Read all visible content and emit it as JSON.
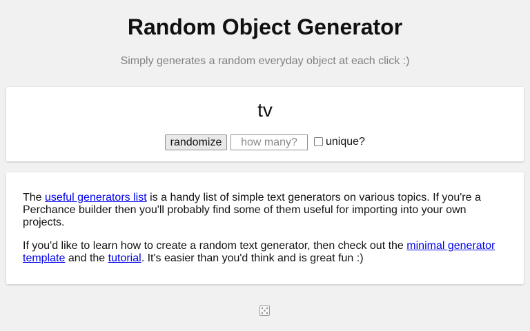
{
  "header": {
    "title": "Random Object Generator",
    "subtitle": "Simply generates a random everyday object at each click :)"
  },
  "generator": {
    "output": "tv",
    "randomize_label": "randomize",
    "count_placeholder": "how many?",
    "count_value": "",
    "unique_label": "unique?",
    "unique_checked": false
  },
  "info": {
    "p1": {
      "pre": "The ",
      "link": "useful generators list",
      "post": " is a handy list of simple text generators on various topics. If you're a Perchance builder then you'll probably find some of them useful for importing into your own projects."
    },
    "p2": {
      "pre": "If you'd like to learn how to create a random text generator, then check out the ",
      "link1": "minimal generator template",
      "mid": " and the ",
      "link2": "tutorial",
      "post": ". It's easier than you'd think and is great fun :)"
    }
  },
  "footer": {
    "icon": "dice-icon"
  },
  "colors": {
    "background": "#f1f1f1",
    "card": "#ffffff",
    "link": "#0000ee",
    "subtitle": "#808080"
  }
}
